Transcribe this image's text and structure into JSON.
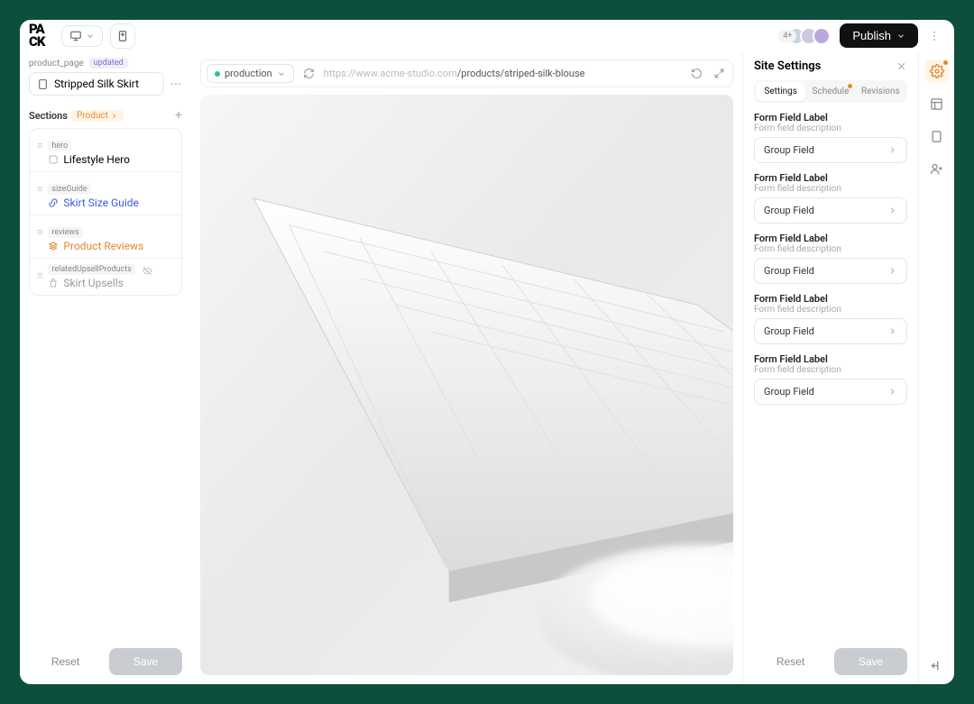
{
  "topbar": {
    "publish_label": "Publish",
    "avatar_overflow": "4+"
  },
  "left": {
    "slug": "product_page",
    "status": "updated",
    "title": "Stripped Silk Skirt",
    "sections_label": "Sections",
    "product_chip": "Product",
    "items": [
      {
        "tag": "hero",
        "title": "Lifestyle Hero",
        "variant": "default"
      },
      {
        "tag": "sizeGuide",
        "title": "Skirt Size Guide",
        "variant": "blue"
      },
      {
        "tag": "reviews",
        "title": "Product Reviews",
        "variant": "orange"
      },
      {
        "tag": "relatedUpsellProducts",
        "title": "Skirt Upsells",
        "variant": "muted",
        "hidden": true
      }
    ],
    "reset": "Reset",
    "save": "Save"
  },
  "center": {
    "env": "production",
    "url_prefix": "https://www.acme-studio.com",
    "url_path": "/products/striped-silk-blouse"
  },
  "right": {
    "title": "Site Settings",
    "tabs": {
      "settings": "Settings",
      "schedule": "Schedule",
      "revisions": "Revisions"
    },
    "fields": [
      {
        "label": "Form Field Label",
        "desc": "Form field description",
        "value": "Group Field"
      },
      {
        "label": "Form Field Label",
        "desc": "Form field description",
        "value": "Group Field"
      },
      {
        "label": "Form Field Label",
        "desc": "Form field description",
        "value": "Group Field"
      },
      {
        "label": "Form Field Label",
        "desc": "Form field description",
        "value": "Group Field"
      },
      {
        "label": "Form Field Label",
        "desc": "Form field description",
        "value": "Group Field"
      }
    ],
    "reset": "Reset",
    "save": "Save"
  }
}
